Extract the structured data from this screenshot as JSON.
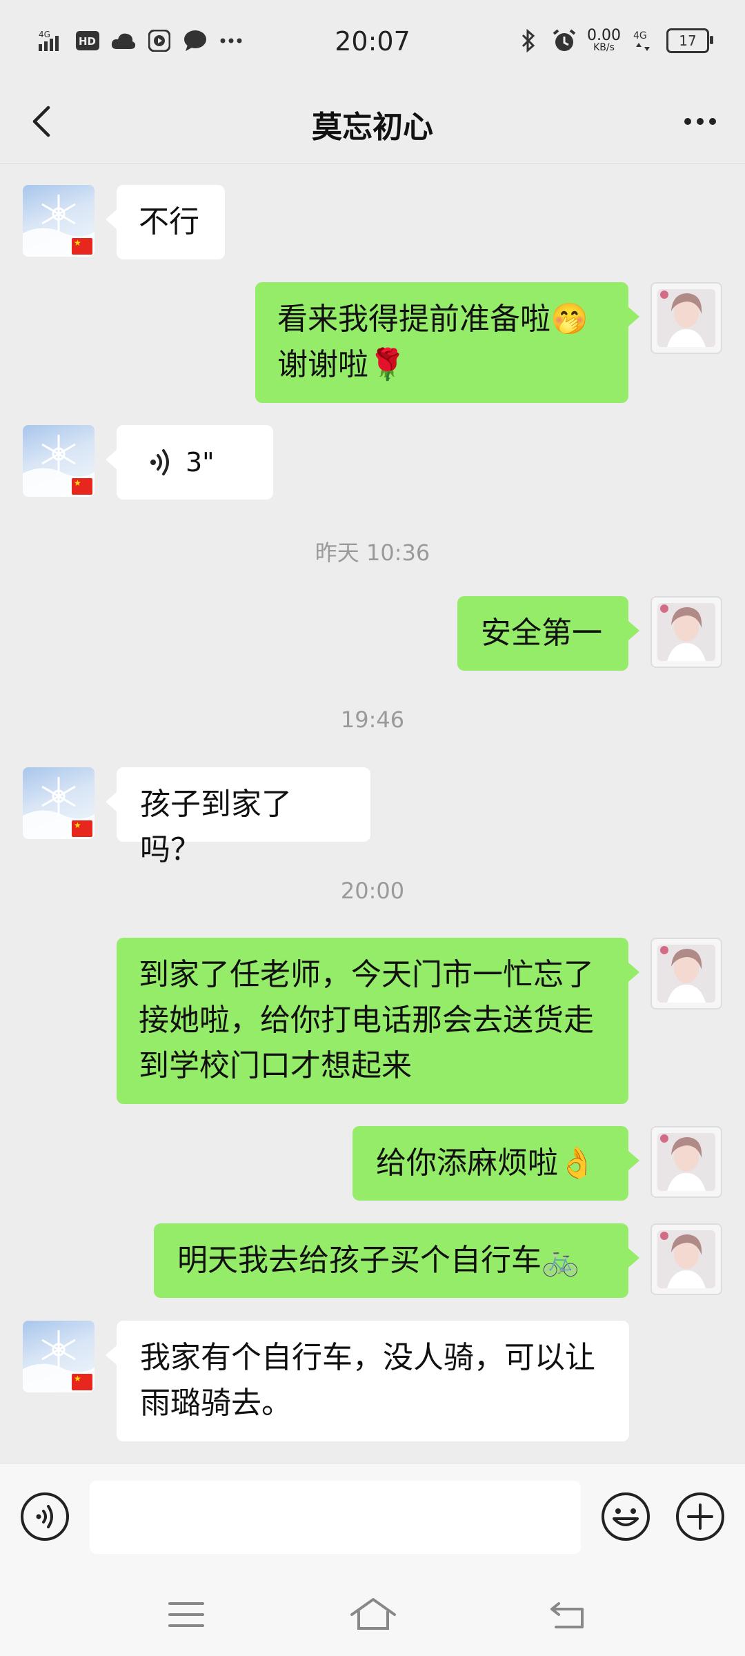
{
  "status_bar": {
    "time": "20:07",
    "network_speed": "0.00",
    "network_unit": "KB/s",
    "battery": "17"
  },
  "header": {
    "title": "莫忘初心"
  },
  "messages": [
    {
      "type": "text",
      "from": "other",
      "text": "不行"
    },
    {
      "type": "text",
      "from": "me",
      "line1": "看来我得提前准备啦🤭",
      "line2": "谢谢啦🌹"
    },
    {
      "type": "voice",
      "from": "other",
      "duration": "3\""
    },
    {
      "type": "time",
      "text": "昨天 10:36"
    },
    {
      "type": "text",
      "from": "me",
      "text": "安全第一"
    },
    {
      "type": "time",
      "text": "19:46"
    },
    {
      "type": "text",
      "from": "other",
      "text": "孩子到家了吗？"
    },
    {
      "type": "time",
      "text": "20:00"
    },
    {
      "type": "text",
      "from": "me",
      "line1": "到家了任老师，今天门市一忙忘了",
      "line2": "接她啦，给你打电话那会去送货走",
      "line3": "到学校门口才想起来"
    },
    {
      "type": "text",
      "from": "me",
      "text": "给你添麻烦啦👌"
    },
    {
      "type": "text",
      "from": "me",
      "text": "明天我去给孩子买个自行车🚲"
    },
    {
      "type": "text",
      "from": "other",
      "line1": "我家有个自行车，没人骑，可以让",
      "line2": "雨璐骑去。"
    }
  ],
  "colors": {
    "outgoing_bubble": "#95ec69",
    "incoming_bubble": "#ffffff",
    "background": "#ededed"
  }
}
